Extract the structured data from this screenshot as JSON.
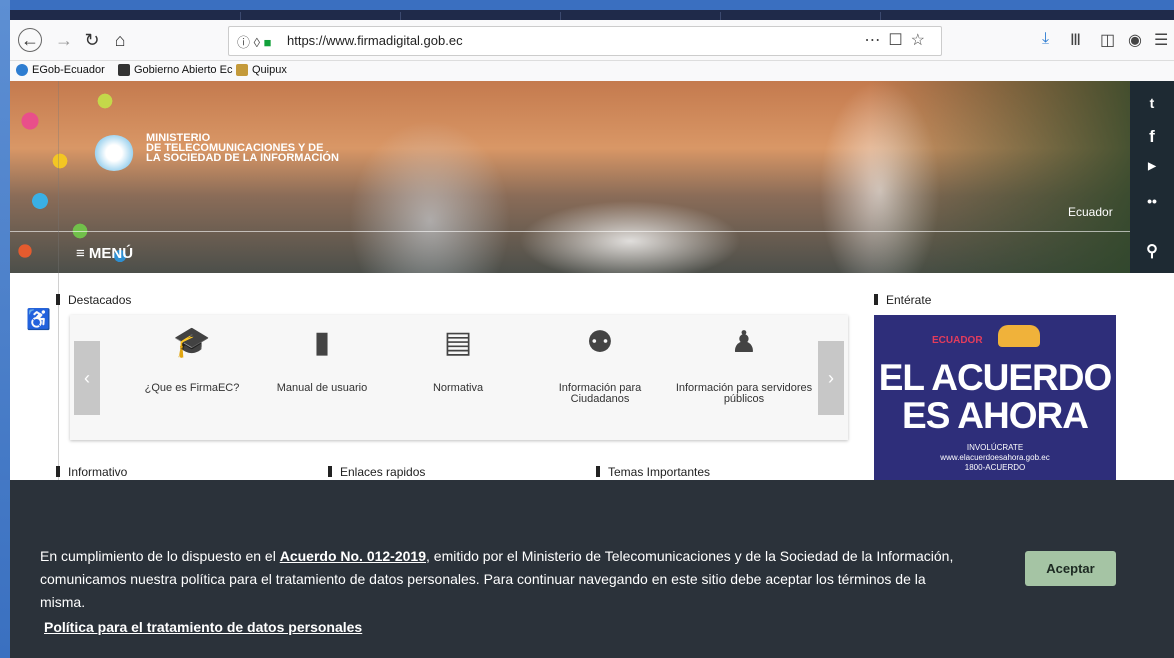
{
  "browser": {
    "url": "https://www.firmadigital.gob.ec",
    "icons": [
      "back-icon",
      "forward-icon",
      "reload-icon",
      "home-icon",
      "info-icon",
      "shield-icon",
      "lock-icon",
      "more-icon",
      "pocket-icon",
      "star-icon",
      "download-icon",
      "library-icon",
      "sidebar-icon",
      "account-icon",
      "menu-icon"
    ]
  },
  "bookmarks": [
    {
      "label": "EGob-Ecuador",
      "color": "#2e7dd1"
    },
    {
      "label": "Gobierno Abierto Ec",
      "color": "#333333"
    },
    {
      "label": "Quipux",
      "color": "#c49a3a"
    }
  ],
  "hero": {
    "ministry_line1": "MINISTERIO",
    "ministry_line2": "DE TELECOMUNICACIONES Y DE",
    "ministry_line3": "LA SOCIEDAD DE LA INFORMACIÓN",
    "country": "Ecuador",
    "menu_label": "≡ MENÚ"
  },
  "social": [
    "twitter-icon",
    "facebook-icon",
    "youtube-icon",
    "flickr-icon",
    "search-icon"
  ],
  "sections": {
    "destacados": "Destacados",
    "enterate": "Entérate",
    "informativo": "Informativo",
    "enlaces": "Enlaces rapidos",
    "temas": "Temas Importantes"
  },
  "carousel": {
    "prev": "‹",
    "next": "›",
    "items": [
      {
        "label": "¿Que es FirmaEC?",
        "icon": "graduation-cap-icon"
      },
      {
        "label": "Manual de usuario",
        "icon": "book-icon"
      },
      {
        "label": "Normativa",
        "icon": "document-icon"
      },
      {
        "label": "Información para Ciudadanos",
        "icon": "people-icon"
      },
      {
        "label": "Información para servidores públicos",
        "icon": "user-tie-icon"
      }
    ]
  },
  "ad": {
    "tag": "ECUADOR",
    "headline1": "EL ACUERDO",
    "headline2": "ES AHORA",
    "line1": "INVOLÚCRATE",
    "line2": "www.elacuerdoesahora.gob.ec",
    "line3": "1800-ACUERDO",
    "colors": {
      "bg": "#2e2e7a",
      "hands": "#f0b23a",
      "tag": "#e43c5c"
    }
  },
  "cookie": {
    "text_before": "En cumplimiento de lo dispuesto en el ",
    "link": "Acuerdo No. 012-2019",
    "text_after": ", emitido por el Ministerio de Telecomunicaciones y de la Sociedad de la Información, comunicamos nuestra política para el tratamiento de datos personales. Para continuar navegando en este sitio debe aceptar los términos de la misma.",
    "policy_link": "Política para el tratamiento de datos personales",
    "accept_label": "Aceptar",
    "colors": {
      "bg": "#2b323a",
      "button": "#a5c4a4"
    }
  }
}
